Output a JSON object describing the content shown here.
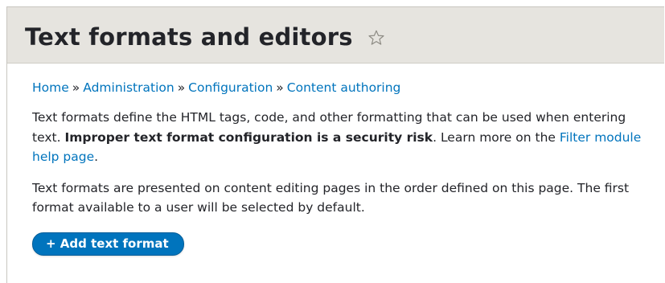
{
  "header": {
    "title": "Text formats and editors",
    "shortcut_icon": "star-outline-icon"
  },
  "breadcrumb": {
    "items": [
      "Home",
      "Administration",
      "Configuration",
      "Content authoring"
    ],
    "separator": "»"
  },
  "intro": {
    "text_before": "Text formats define the HTML tags, code, and other formatting that can be used when entering text. ",
    "warning": "Improper text format configuration is a security risk",
    "text_after_warning": ". Learn more on the ",
    "help_link": "Filter module help page",
    "text_end": "."
  },
  "order_note": "Text formats are presented on content editing pages in the order defined on this page. The first format available to a user will be selected by default.",
  "actions": {
    "add_button_label": "+ Add text format"
  },
  "colors": {
    "link": "#0074bd",
    "header_bg": "#e6e4df",
    "button_bg": "#0074bd",
    "text": "#232429"
  }
}
